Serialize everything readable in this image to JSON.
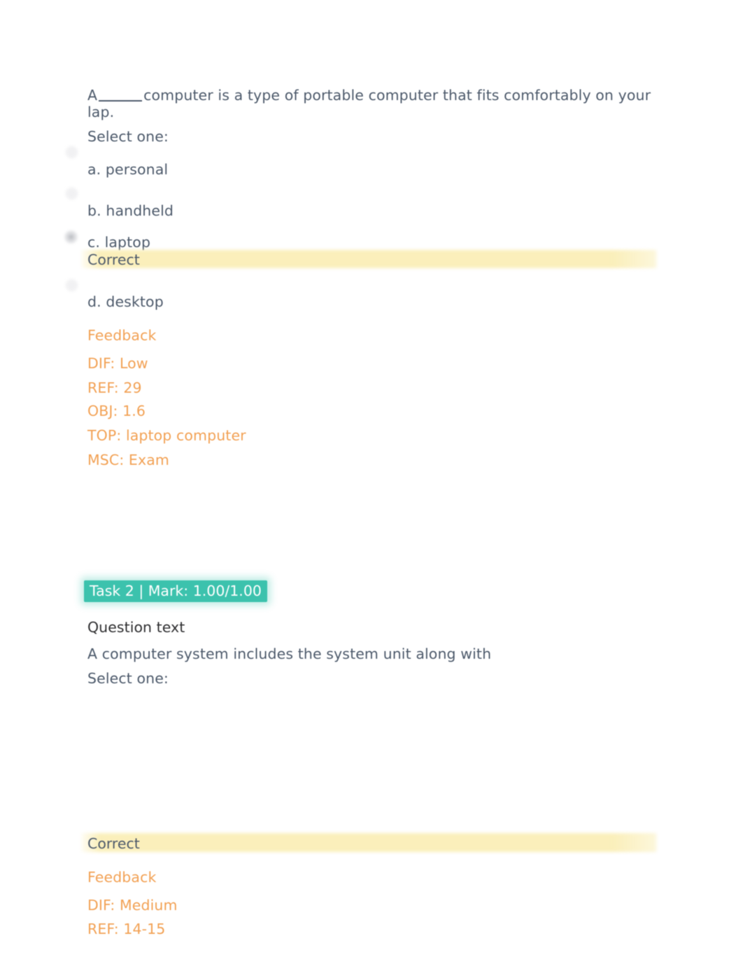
{
  "document": {
    "background_color": "#ffffff",
    "body_text_color": "#4d5a6b",
    "feedback_color": "#f2a154",
    "highlight_color": "#faeeb7",
    "badge_color": "#3cc2ad",
    "heading_color": "#2e2e30"
  },
  "question1": {
    "stem_line1_before_blank": "A",
    "stem_blank": "_____",
    "stem_line1_after_blank": "computer is a type of portable computer that fits comfortably on your",
    "stem_line2": "lap.",
    "select_prompt": "Select one:",
    "options": [
      {
        "id": "a",
        "label": "a. personal",
        "selected": false
      },
      {
        "id": "b",
        "label": "b. handheld",
        "selected": false
      },
      {
        "id": "c",
        "label": "c. laptop",
        "selected": true
      },
      {
        "id": "d",
        "label": "d. desktop",
        "selected": false
      }
    ],
    "result_label": "Correct",
    "feedback_heading": "Feedback",
    "feedback_lines": [
      "DIF: Low",
      "REF: 29",
      "OBJ: 1.6",
      "TOP: laptop computer",
      "MSC: Exam"
    ]
  },
  "question2": {
    "badge_label": "Task 2 | Mark: 1.00/1.00",
    "question_text_heading": "Question text",
    "stem": "A computer system includes the system unit along with",
    "select_prompt": "Select one:",
    "result_label": "Correct",
    "feedback_heading": "Feedback",
    "feedback_lines": [
      "DIF: Medium",
      "REF: 14-15"
    ]
  }
}
